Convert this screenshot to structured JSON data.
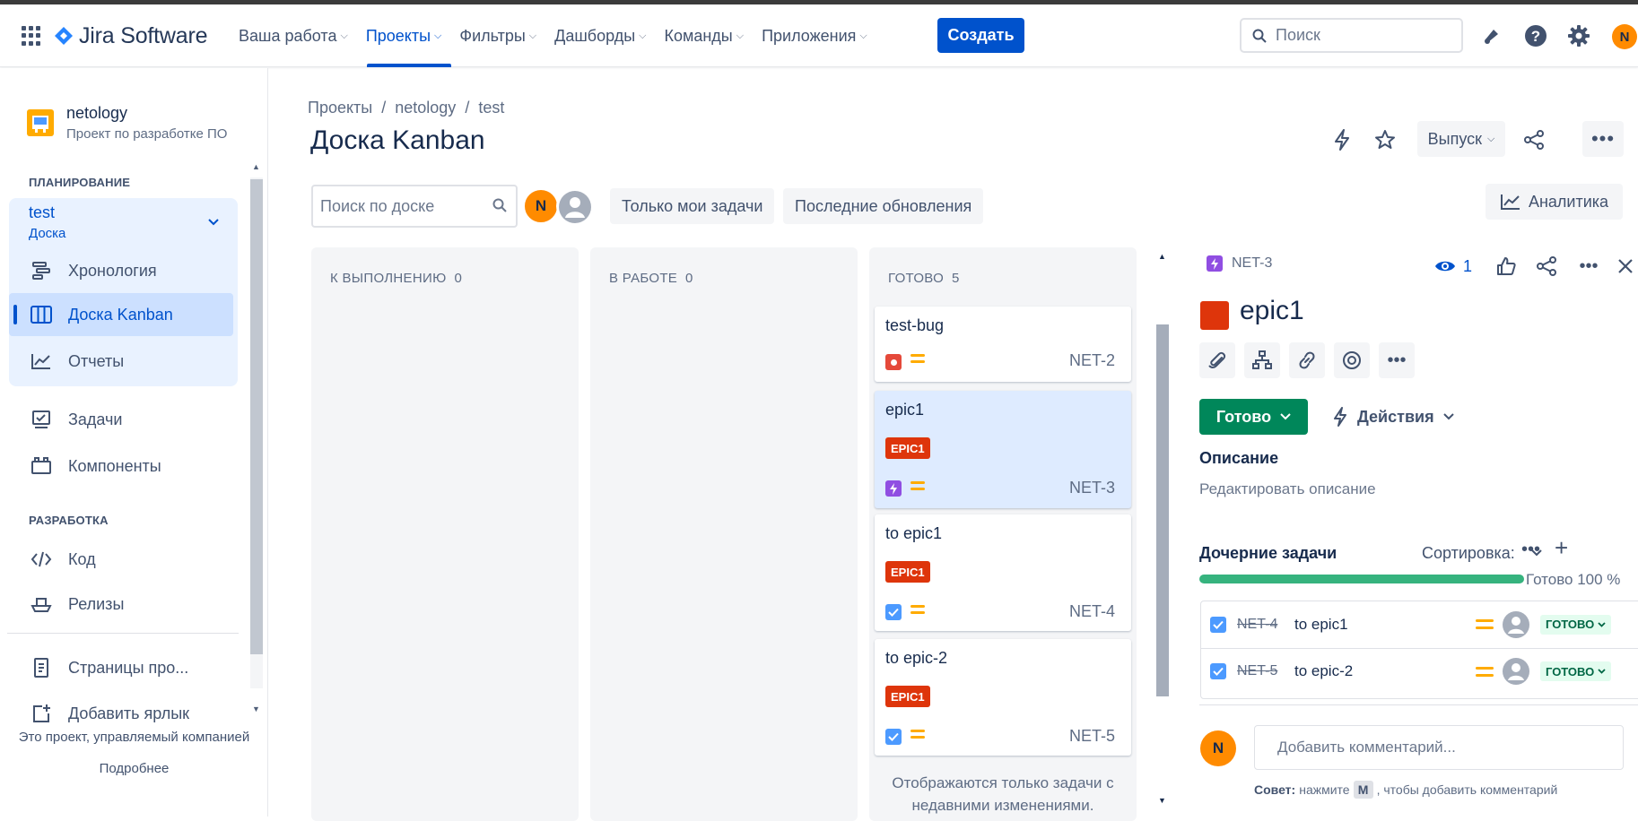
{
  "app": {
    "name": "Jira Software"
  },
  "nav": {
    "items": [
      {
        "label": "Ваша работа"
      },
      {
        "label": "Проекты"
      },
      {
        "label": "Фильтры"
      },
      {
        "label": "Дашборды"
      },
      {
        "label": "Команды"
      },
      {
        "label": "Приложения"
      }
    ],
    "create_label": "Создать",
    "search_placeholder": "Поиск",
    "user_initial": "N"
  },
  "sidebar": {
    "project_name": "netology",
    "project_sub": "Проект по разработке ПО",
    "planning_header": "ПЛАНИРОВАНИЕ",
    "board_name": "test",
    "board_sub": "Доска",
    "planning_items": [
      {
        "label": "Хронология"
      },
      {
        "label": "Доска Kanban"
      },
      {
        "label": "Отчеты"
      }
    ],
    "other_items": [
      {
        "label": "Задачи"
      },
      {
        "label": "Компоненты"
      }
    ],
    "dev_header": "РАЗРАБОТКА",
    "dev_items": [
      {
        "label": "Код"
      },
      {
        "label": "Релизы"
      }
    ],
    "extra_items": [
      {
        "label": "Страницы про..."
      },
      {
        "label": "Добавить ярлык"
      }
    ],
    "footer": "Это проект, управляемый компанией",
    "footer_link": "Подробнее"
  },
  "board": {
    "breadcrumb": [
      "Проекты",
      "/",
      "netology",
      "/",
      "test"
    ],
    "title": "Доска Kanban",
    "release_label": "Выпуск",
    "search_placeholder": "Поиск по доске",
    "filter_avatar_initial": "N",
    "filter_my": "Только мои задачи",
    "filter_recent": "Последние обновления",
    "analytics_label": "Аналитика",
    "columns": [
      {
        "title": "К ВЫПОЛНЕНИЮ",
        "count": "0"
      },
      {
        "title": "В РАБОТЕ",
        "count": "0"
      },
      {
        "title": "ГОТОВО",
        "count": "5"
      }
    ],
    "cards": [
      {
        "title": "test-bug",
        "key": "NET-2",
        "epic": ""
      },
      {
        "title": "epic1",
        "key": "NET-3",
        "epic": "EPIC1"
      },
      {
        "title": "to epic1",
        "key": "NET-4",
        "epic": "EPIC1"
      },
      {
        "title": "to epic-2",
        "key": "NET-5",
        "epic": "EPIC1"
      }
    ],
    "done_note": "Отображаются только задачи с недавними изменениями."
  },
  "issue": {
    "key": "NET-3",
    "watchers": "1",
    "title": "epic1",
    "status": "Готово",
    "actions_label": "Действия",
    "description_header": "Описание",
    "description_placeholder": "Редактировать описание",
    "children_header": "Дочерние задачи",
    "sort_label": "Сортировка:",
    "progress_text": "Готово 100 %",
    "progress_fraction": 1.0,
    "children": [
      {
        "key": "NET-4",
        "summary": "to epic1",
        "status": "ГОТОВО"
      },
      {
        "key": "NET-5",
        "summary": "to epic-2",
        "status": "ГОТОВО"
      }
    ],
    "comment_avatar_initial": "N",
    "comment_placeholder": "Добавить комментарий...",
    "tip_prefix": "Совет:",
    "tip_press": "нажмите",
    "tip_key": "M",
    "tip_suffix": ", чтобы добавить комментарий"
  },
  "colors": {
    "brand": "#0052cc",
    "done": "#00875a",
    "epic": "#de350b",
    "bug": "#e5493a",
    "story_epic_icon": "#904ee2"
  }
}
